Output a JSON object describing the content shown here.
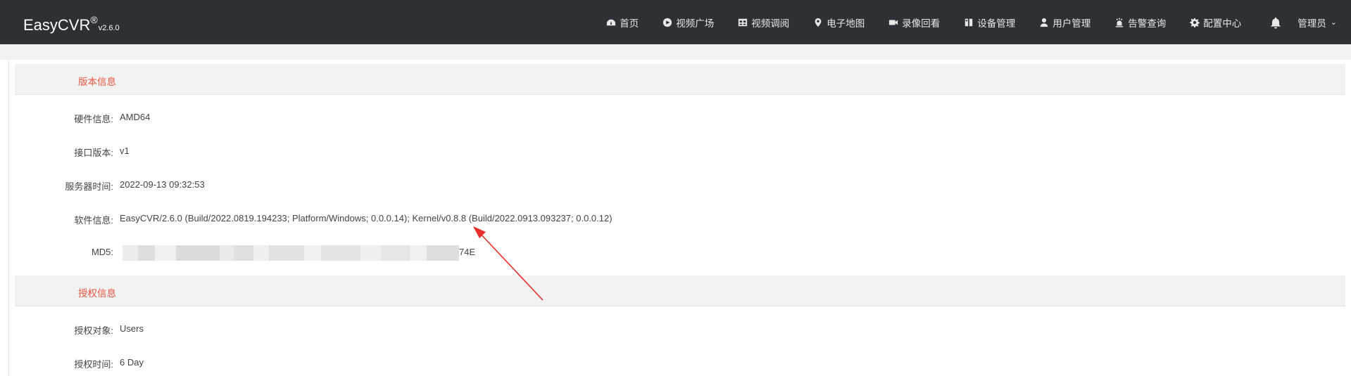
{
  "app": {
    "brand": "EasyCVR",
    "registered": "®",
    "version": "v2.6.0"
  },
  "nav": {
    "items": [
      {
        "label": "首页",
        "icon": "dashboard-icon"
      },
      {
        "label": "视频广场",
        "icon": "play-circle-icon"
      },
      {
        "label": "视频调阅",
        "icon": "grid-view-icon"
      },
      {
        "label": "电子地图",
        "icon": "map-pin-icon"
      },
      {
        "label": "录像回看",
        "icon": "video-camera-icon"
      },
      {
        "label": "设备管理",
        "icon": "device-icon"
      },
      {
        "label": "用户管理",
        "icon": "user-icon"
      },
      {
        "label": "告警查询",
        "icon": "alarm-icon"
      },
      {
        "label": "配置中心",
        "icon": "gear-icon"
      }
    ],
    "bell_icon": "bell-icon",
    "user_label": "管理员",
    "user_caret": "⌄"
  },
  "sections": {
    "version_title": "版本信息",
    "license_title": "授权信息"
  },
  "version_info": {
    "hardware_label": "硬件信息:",
    "hardware_value": "AMD64",
    "api_label": "接口版本:",
    "api_value": "v1",
    "server_time_label": "服务器时间:",
    "server_time_value": "2022-09-13 09:32:53",
    "software_label": "软件信息:",
    "software_value": "EasyCVR/2.6.0 (Build/2022.0819.194233; Platform/Windows; 0.0.0.14); Kernel/v0.8.8 (Build/2022.0913.093237; 0.0.0.12)",
    "md5_label": "MD5:",
    "md5_visible_suffix": "74E"
  },
  "license_info": {
    "target_label": "授权对象:",
    "target_value": "Users",
    "time_label": "授权时间:",
    "time_value": "6 Day"
  },
  "colors": {
    "topbar": "#2d3035",
    "accent": "#e8553e",
    "arrow": "#e8302a"
  }
}
